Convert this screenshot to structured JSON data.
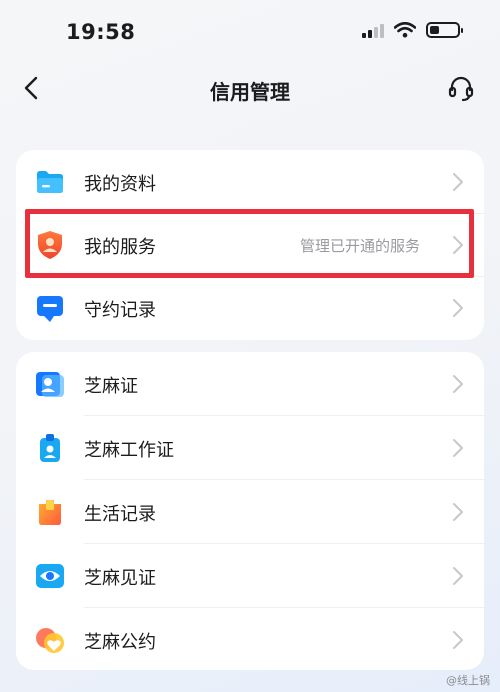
{
  "status_bar": {
    "time": "19:58"
  },
  "nav": {
    "title": "信用管理"
  },
  "group1": {
    "items": [
      {
        "label": "我的资料",
        "subtitle": ""
      },
      {
        "label": "我的服务",
        "subtitle": "管理已开通的服务"
      },
      {
        "label": "守约记录",
        "subtitle": ""
      }
    ]
  },
  "group2": {
    "items": [
      {
        "label": "芝麻证"
      },
      {
        "label": "芝麻工作证"
      },
      {
        "label": "生活记录"
      },
      {
        "label": "芝麻见证"
      },
      {
        "label": "芝麻公约"
      }
    ]
  },
  "highlight": {
    "target": "我的服务",
    "color": "#e8303d"
  },
  "watermark": "@线上锅"
}
